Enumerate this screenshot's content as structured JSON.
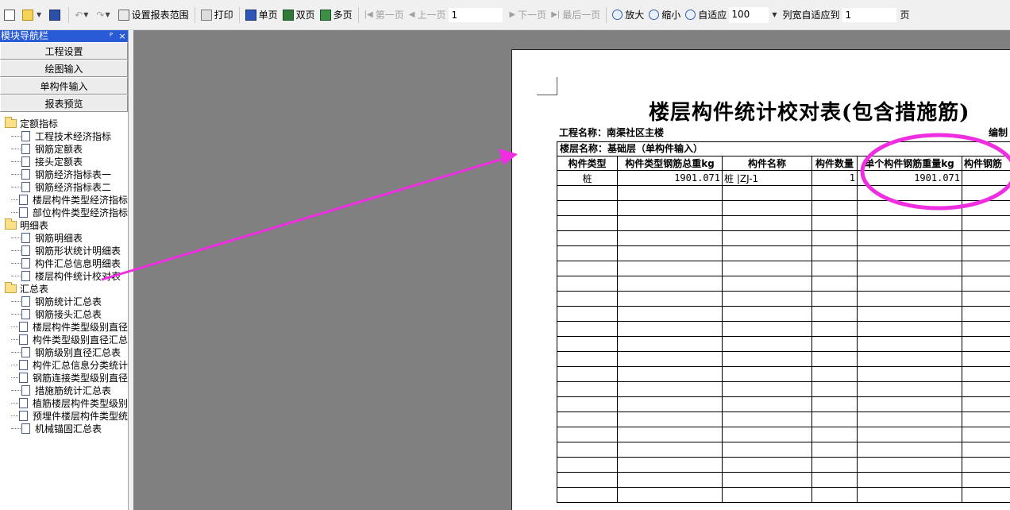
{
  "toolbar": {
    "set_range": "设置报表范围",
    "print": "打印",
    "single_page": "单页",
    "double_page": "双页",
    "multi_page": "多页",
    "first_page": "第一页",
    "prev_page": "上一页",
    "page_number": "1",
    "next_page": "下一页",
    "last_page": "最后一页",
    "zoom_in": "放大",
    "zoom_out": "缩小",
    "fit": "自适应",
    "zoom_value": "100",
    "col_fit_label": "列宽自适应到",
    "col_fit_value": "1",
    "page_suffix": "页"
  },
  "panel": {
    "title": "模块导航栏",
    "pin": "ᴘ",
    "close": "×",
    "nav_buttons": [
      "工程设置",
      "绘图输入",
      "单构件输入",
      "报表预览"
    ],
    "groups": [
      {
        "label": "定额指标",
        "items": [
          "工程技术经济指标",
          "钢筋定额表",
          "接头定额表",
          "钢筋经济指标表一",
          "钢筋经济指标表二",
          "楼层构件类型经济指标",
          "部位构件类型经济指标"
        ]
      },
      {
        "label": "明细表",
        "items": [
          "钢筋明细表",
          "钢筋形状统计明细表",
          "构件汇总信息明细表",
          "楼层构件统计校对表"
        ]
      },
      {
        "label": "汇总表",
        "items": [
          "钢筋统计汇总表",
          "钢筋接头汇总表",
          "楼层构件类型级别直径",
          "构件类型级别直径汇总",
          "钢筋级别直径汇总表",
          "构件汇总信息分类统计",
          "钢筋连接类型级别直径",
          "措施筋统计汇总表",
          "植筋楼层构件类型级别",
          "预埋件楼层构件类型统",
          "机械锚固汇总表"
        ]
      }
    ]
  },
  "report": {
    "title": "楼层构件统计校对表(包含措施筋)",
    "project": "工程名称：南渠社区主楼",
    "editor": "编制",
    "floor": "楼层名称：基础层（单构件输入）",
    "headers": [
      "构件类型",
      "构件类型钢筋总重kg",
      "构件名称",
      "构件数量",
      "单个构件钢筋重量kg",
      "构件钢筋"
    ],
    "rows": [
      [
        "桩",
        "1901.071",
        "桩 |ZJ-1",
        "1",
        "1901.071",
        ""
      ]
    ]
  },
  "annotation": {
    "color": "#ee2ee0"
  }
}
